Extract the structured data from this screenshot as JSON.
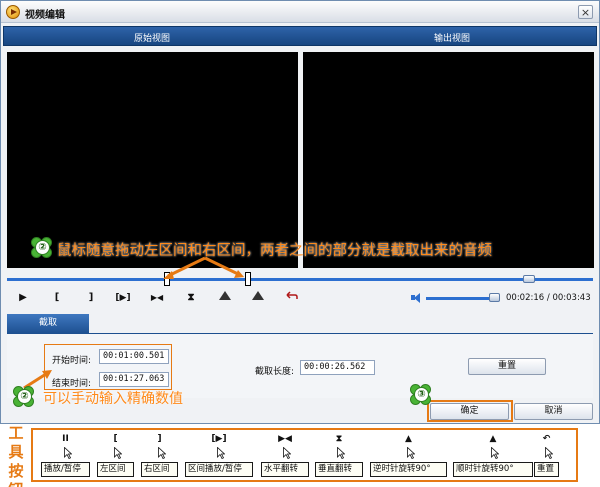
{
  "window": {
    "title": "视频编辑",
    "close_glyph": "×",
    "source_view_label": "原始视图",
    "output_view_label": "输出视图"
  },
  "player": {
    "play_glyph": "▶",
    "set_left_glyph": "[",
    "set_right_glyph": "]",
    "play_range_glyph": "[▶]",
    "flip_h_glyph": "▶◀",
    "flip_v_glyph": "⧗",
    "rotate_ccw_icon": "rotate-ccw-icon",
    "rotate_cw_icon": "rotate-cw-icon",
    "reset_icon": "undo-icon",
    "time_display": "00:02:16 / 00:03:43"
  },
  "trim": {
    "tab_label": "截取",
    "start_label": "开始时间:",
    "start_value": "00:01:00.501",
    "end_label": "结束时间:",
    "end_value": "00:01:27.063",
    "duration_label": "截取长度:",
    "duration_value": "00:00:26.562",
    "reset_label": "重置",
    "ok_label": "确定",
    "cancel_label": "取消"
  },
  "annotations": {
    "marker_1": "②",
    "marker_2": "②",
    "marker_3": "③",
    "drag_hint": "鼠标随意拖动左区间和右区间，两者之间的部分就是截取出来的音频",
    "input_hint": "可以手动输入精确数值",
    "accent_color": "#e67a14"
  },
  "toolbar_legend": {
    "title": "工具按钮",
    "items": [
      {
        "symbol": "II",
        "label": "播放/暂停"
      },
      {
        "symbol": "[",
        "label": "左区间"
      },
      {
        "symbol": "]",
        "label": "右区间"
      },
      {
        "symbol": "[▶]",
        "label": "区间播放/暂停"
      },
      {
        "symbol": "▶◀",
        "label": "水平翻转"
      },
      {
        "symbol": "⧗",
        "label": "垂直翻转"
      },
      {
        "symbol": "▲",
        "label": "逆时针旋转90°"
      },
      {
        "symbol": "▲",
        "label": "顺时针旋转90°"
      },
      {
        "symbol": "↶",
        "label": "重置"
      }
    ]
  }
}
